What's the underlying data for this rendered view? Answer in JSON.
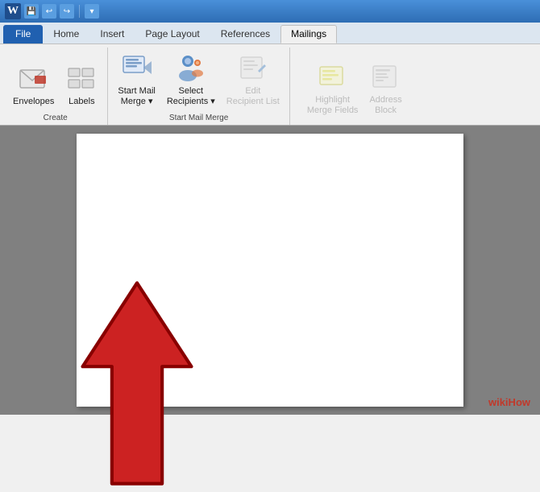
{
  "titlebar": {
    "app_icon": "W",
    "buttons": [
      "undo",
      "redo",
      "quicksave"
    ]
  },
  "tabs": {
    "items": [
      {
        "label": "File",
        "class": "file"
      },
      {
        "label": "Home",
        "class": ""
      },
      {
        "label": "Insert",
        "class": ""
      },
      {
        "label": "Page Layout",
        "class": ""
      },
      {
        "label": "References",
        "class": ""
      },
      {
        "label": "Mailings",
        "class": "active"
      }
    ]
  },
  "ribbon": {
    "groups": [
      {
        "name": "create",
        "label": "Create",
        "buttons": [
          {
            "id": "envelopes",
            "label": "Envelopes",
            "icon": "env"
          },
          {
            "id": "labels",
            "label": "Labels",
            "icon": "lbl"
          }
        ]
      },
      {
        "name": "start-mail-merge",
        "label": "Start Mail Merge",
        "buttons": [
          {
            "id": "start-merge",
            "label": "Start Mail\nMerge ▾",
            "icon": "merge"
          },
          {
            "id": "select-recipients",
            "label": "Select\nRecipients ▾",
            "icon": "select"
          },
          {
            "id": "edit-recipients",
            "label": "Edit\nRecipient List",
            "icon": "edit",
            "disabled": true
          }
        ]
      },
      {
        "name": "write-insert",
        "label": "",
        "buttons": [
          {
            "id": "highlight",
            "label": "Highlight\nMerge Fields",
            "icon": "highlight",
            "disabled": true
          },
          {
            "id": "address-block",
            "label": "Address\nBlock",
            "icon": "address",
            "disabled": true
          }
        ]
      }
    ]
  },
  "wikihow": {
    "prefix": "wiki",
    "brand": "How"
  }
}
